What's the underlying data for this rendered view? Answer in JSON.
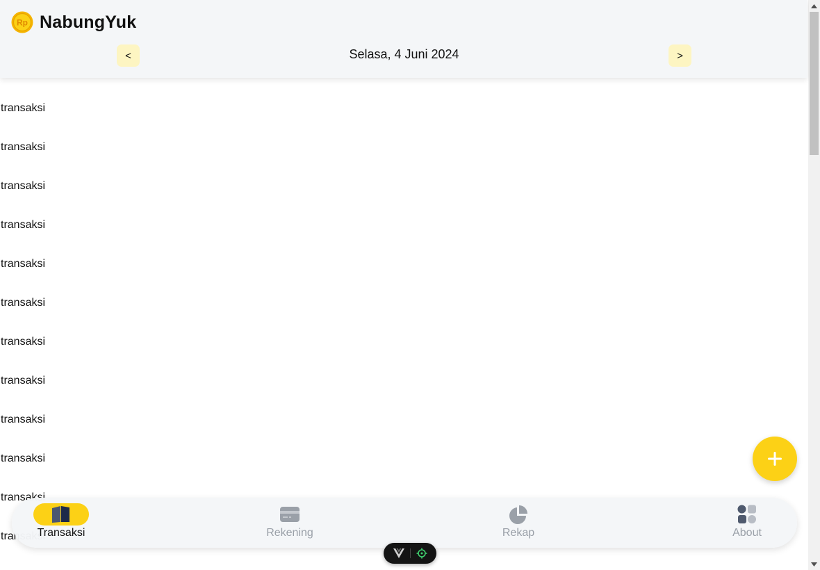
{
  "header": {
    "app_title": "NabungYuk",
    "logo_text": "Rp",
    "date": "Selasa, 4 Juni 2024",
    "prev_label": "<",
    "next_label": ">"
  },
  "transactions": [
    "transaksi",
    "transaksi",
    "transaksi",
    "transaksi",
    "transaksi",
    "transaksi",
    "transaksi",
    "transaksi",
    "transaksi",
    "transaksi",
    "transaksi",
    "transaksi"
  ],
  "fab": {
    "icon": "plus-icon"
  },
  "bottom_nav": {
    "active": "Transaksi",
    "items": [
      {
        "label": "Transaksi",
        "icon": "book-icon"
      },
      {
        "label": "Rekening",
        "icon": "card-icon"
      },
      {
        "label": "Rekap",
        "icon": "pie-chart-icon"
      },
      {
        "label": "About",
        "icon": "grid-icon"
      }
    ]
  },
  "colors": {
    "accent": "#fcd116",
    "nav_button_bg": "#fdf5c2",
    "header_bg": "#f4f6f8",
    "inactive_icon": "#9aa0a8",
    "active_icon": "#1e2a4a"
  }
}
